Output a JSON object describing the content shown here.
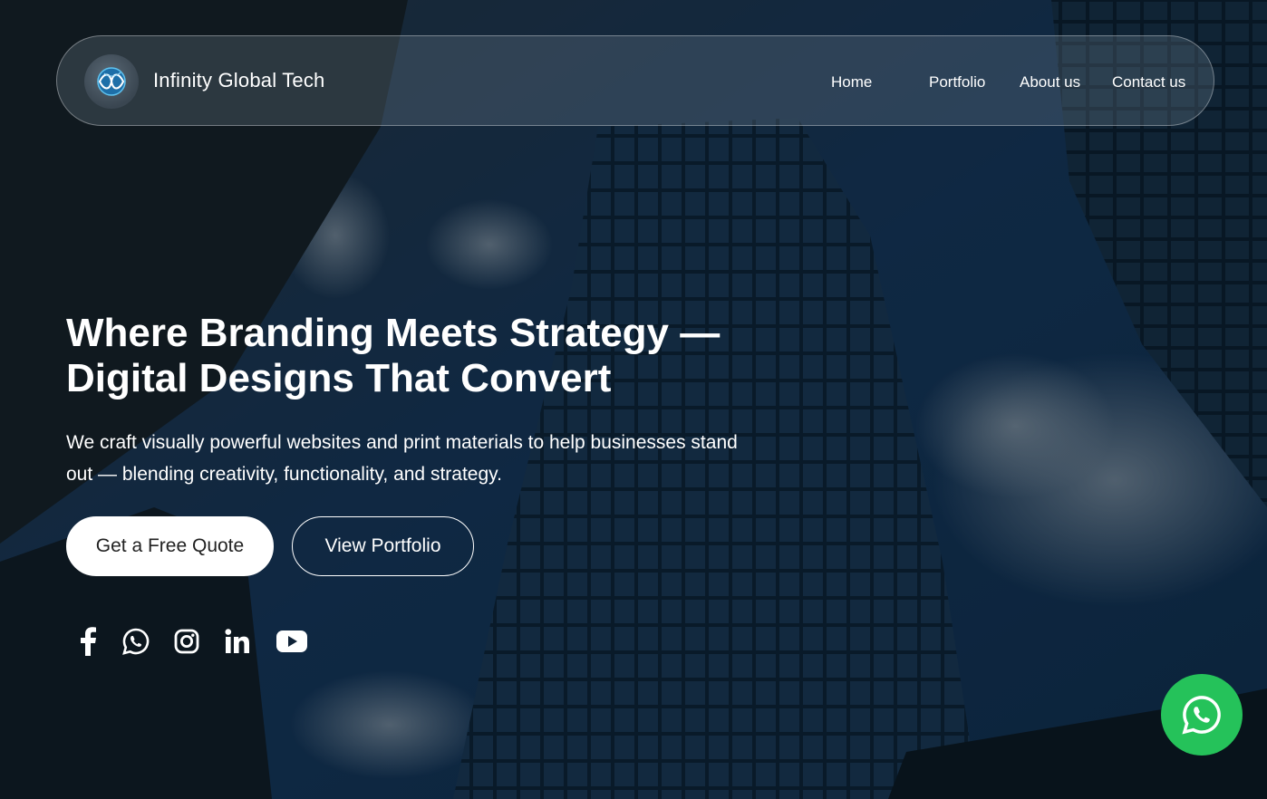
{
  "navbar": {
    "brand": "Infinity Global Tech",
    "logo_icon": "globe-infinity-logo",
    "links": [
      {
        "label": "Home"
      },
      {
        "label": "Portfolio"
      },
      {
        "label": "About us"
      },
      {
        "label": "Contact us"
      }
    ]
  },
  "hero": {
    "headline": "Where Branding Meets Strategy —\nDigital Designs That Convert",
    "subtext": "We craft visually powerful websites and print materials to help businesses stand out — blending creativity, functionality, and strategy.",
    "primary_button": "Get a Free Quote",
    "secondary_button": "View Portfolio"
  },
  "social": [
    {
      "icon": "facebook-icon"
    },
    {
      "icon": "whatsapp-icon"
    },
    {
      "icon": "instagram-icon"
    },
    {
      "icon": "linkedin-icon"
    },
    {
      "icon": "youtube-icon"
    }
  ],
  "floating_button": {
    "icon": "whatsapp-icon",
    "color": "#25c25a"
  },
  "colors": {
    "accent_green": "#25c25a",
    "text": "#ffffff",
    "button_bg": "#ffffff"
  }
}
